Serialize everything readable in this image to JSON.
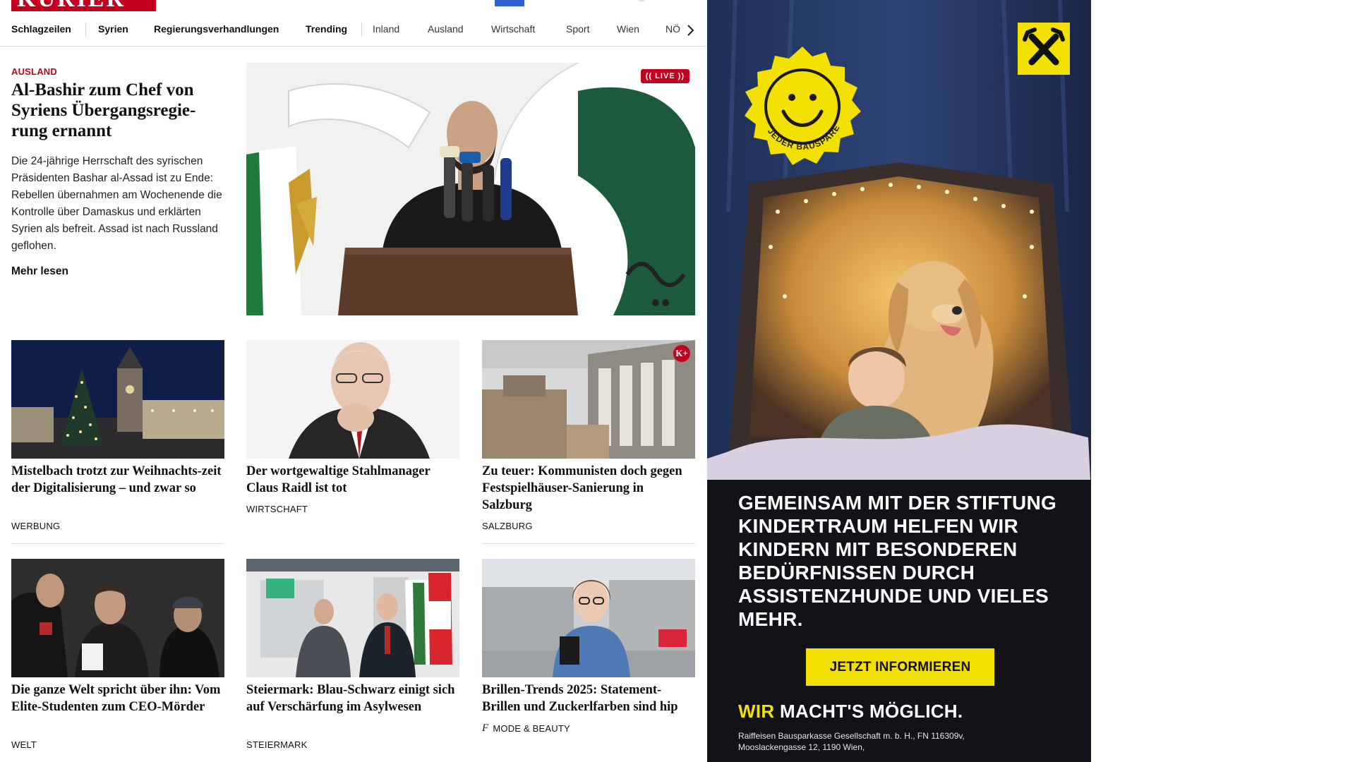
{
  "header": {
    "logo_text": "KURIER"
  },
  "nav": {
    "items": [
      "Schlagzeilen",
      "Syrien",
      "Regierungsverhandlungen",
      "Trending",
      "Inland",
      "Ausland",
      "Wirtschaft",
      "Sport",
      "Wien",
      "NÖ"
    ],
    "chevron_icon": "chevron-right-icon"
  },
  "lead": {
    "category": "AUSLAND",
    "title": "Al-Bashir zum Chef von Syriens Übergangsregie-rung ernannt",
    "text": "Die 24-jährige Herrschaft des syrischen Präsidenten Bashar al-Assad ist zu Ende: Rebellen übernahmen am Wochenende die Kontrolle über Damaskus und erklärten Syrien als befreit. Assad ist nach Russland geflohen.",
    "more_label": "Mehr lesen",
    "live_badge": "(( LIVE ))"
  },
  "cards": [
    {
      "title": "Mistelbach trotzt zur Weihnachts-zeit der Digitalisierung – und zwar so",
      "category": "WERBUNG"
    },
    {
      "title": "Der wortgewaltige Stahlmanager Claus Raidl ist tot",
      "category": "WIRTSCHAFT"
    },
    {
      "title": "Zu teuer: Kommunisten doch gegen Festspielhäuser-Sanierung in Salzburg",
      "category": "SALZBURG",
      "badge": "K+"
    },
    {
      "title": "Die ganze Welt spricht über ihn: Vom Elite-Studenten zum CEO-Mörder",
      "category": "WELT"
    },
    {
      "title": "Steiermark: Blau-Schwarz einigt sich auf Verschärfung im Asylwesen",
      "category": "STEIERMARK"
    },
    {
      "title": "Brillen-Trends 2025: Statement-Brillen und Zuckerlfarben sind hip",
      "category": "MODE & BEAUTY",
      "category_icon": "f"
    }
  ],
  "ad": {
    "badge_text": "JEDER BAUSPARER HILFT",
    "headline": "GEMEINSAM MIT DER STIFTUNG KINDERTRAUM HELFEN WIR KINDERN MIT BESONDEREN BEDÜRFNISSEN DURCH ASSISTENZHUNDE UND VIELES MEHR.",
    "cta": "JETZT INFORMIEREN",
    "slogan_highlight": "WIR",
    "slogan_rest": "MACHT'S MÖGLICH.",
    "legal": "Raiffeisen Bausparkasse Gesellschaft m. b. H., FN 116309v, Mooslackengasse 12, 1190 Wien,",
    "colors": {
      "yellow": "#f2e100",
      "dark": "#1b1f2c"
    }
  },
  "colors": {
    "brand_red": "#c4001f",
    "text": "#111111",
    "rule": "#dcdcdc"
  }
}
